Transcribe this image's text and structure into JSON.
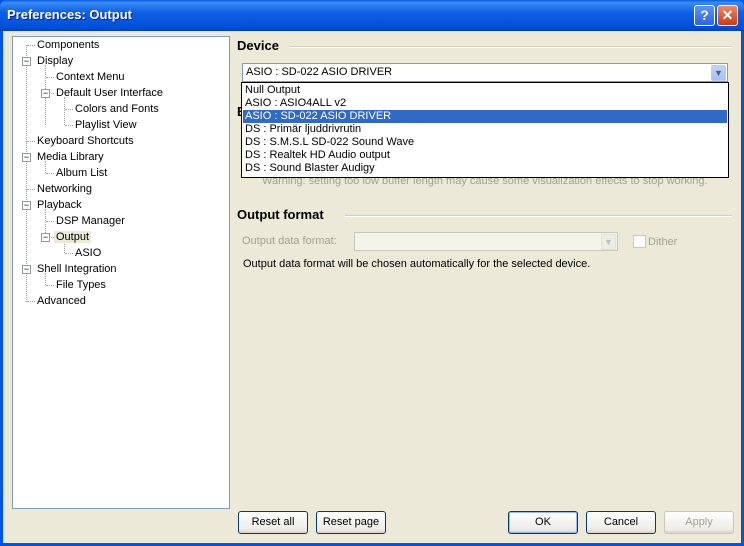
{
  "window": {
    "title": "Preferences: Output"
  },
  "tree": [
    {
      "label": "Components"
    },
    {
      "label": "Display"
    },
    {
      "label": "Context Menu"
    },
    {
      "label": "Default User Interface"
    },
    {
      "label": "Colors and Fonts"
    },
    {
      "label": "Playlist View"
    },
    {
      "label": "Keyboard Shortcuts"
    },
    {
      "label": "Media Library"
    },
    {
      "label": "Album List"
    },
    {
      "label": "Networking"
    },
    {
      "label": "Playback"
    },
    {
      "label": "DSP Manager"
    },
    {
      "label": "Output"
    },
    {
      "label": "ASIO"
    },
    {
      "label": "Shell Integration"
    },
    {
      "label": "File Types"
    },
    {
      "label": "Advanced"
    }
  ],
  "device": {
    "section_title": "Device",
    "selected": "ASIO : SD-022 ASIO DRIVER",
    "options": [
      "Null Output",
      "ASIO : ASIO4ALL v2",
      "ASIO : SD-022 ASIO DRIVER",
      "DS : Primär ljuddrivrutin",
      "DS : S.M.S.L  SD-022 Sound Wave",
      "DS : Realtek HD Audio output",
      "DS : Sound Blaster Audigy"
    ],
    "warning": "Warning: setting too low buffer length may cause some visualization effects to stop working."
  },
  "output_format": {
    "section_title": "Output format",
    "label": "Output data format:",
    "value": "",
    "dither_label": "Dither",
    "note": "Output data format will be chosen automatically for the selected device."
  },
  "buttons": {
    "reset_all": "Reset all",
    "reset_page": "Reset page",
    "ok": "OK",
    "cancel": "Cancel",
    "apply": "Apply"
  }
}
